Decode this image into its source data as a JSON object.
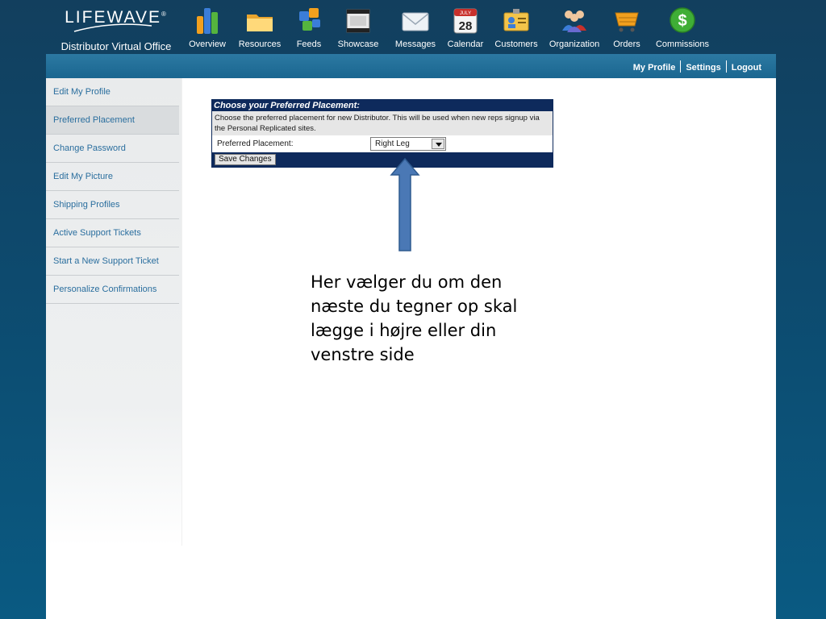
{
  "brand": {
    "logo_text": "LIFEWAVE",
    "subtitle": "Distributor Virtual Office"
  },
  "nav": [
    {
      "label": "Overview",
      "icon": "chart-icon"
    },
    {
      "label": "Resources",
      "icon": "folder-icon"
    },
    {
      "label": "Feeds",
      "icon": "feeds-icon"
    },
    {
      "label": "Showcase",
      "icon": "film-icon"
    },
    {
      "label": "Messages",
      "icon": "envelope-icon"
    },
    {
      "label": "Calendar",
      "icon": "calendar-icon",
      "calendar_month": "JULY",
      "calendar_day": "28"
    },
    {
      "label": "Customers",
      "icon": "id-card-icon"
    },
    {
      "label": "Organization",
      "icon": "people-icon"
    },
    {
      "label": "Orders",
      "icon": "cart-icon"
    },
    {
      "label": "Commissions",
      "icon": "dollar-icon",
      "symbol": "$"
    }
  ],
  "subbar": {
    "my_profile": "My Profile",
    "settings": "Settings",
    "logout": "Logout"
  },
  "sidebar": {
    "items": [
      {
        "label": "Edit My Profile"
      },
      {
        "label": "Preferred Placement"
      },
      {
        "label": "Change Password"
      },
      {
        "label": "Edit My Picture"
      },
      {
        "label": "Shipping Profiles"
      },
      {
        "label": "Active Support Tickets"
      },
      {
        "label": "Start a New Support Ticket"
      },
      {
        "label": "Personalize Confirmations"
      }
    ],
    "active_index": 1
  },
  "form": {
    "title": "Choose your Preferred Placement:",
    "description": "Choose the preferred placement for new Distributor. This will be used when new reps signup via the Personal Replicated sites.",
    "field_label": "Preferred Placement:",
    "selected_value": "Right Leg",
    "save_label": "Save Changes"
  },
  "annotation": "Her vælger du om den næste du tegner op skal lægge i højre eller din venstre side",
  "colors": {
    "header_bg": "#123f5e",
    "subbar": "#2c79a2",
    "form_header": "#0e2a5c",
    "sidebar_text": "#2a6e9e",
    "arrow": "#4a78b5"
  }
}
